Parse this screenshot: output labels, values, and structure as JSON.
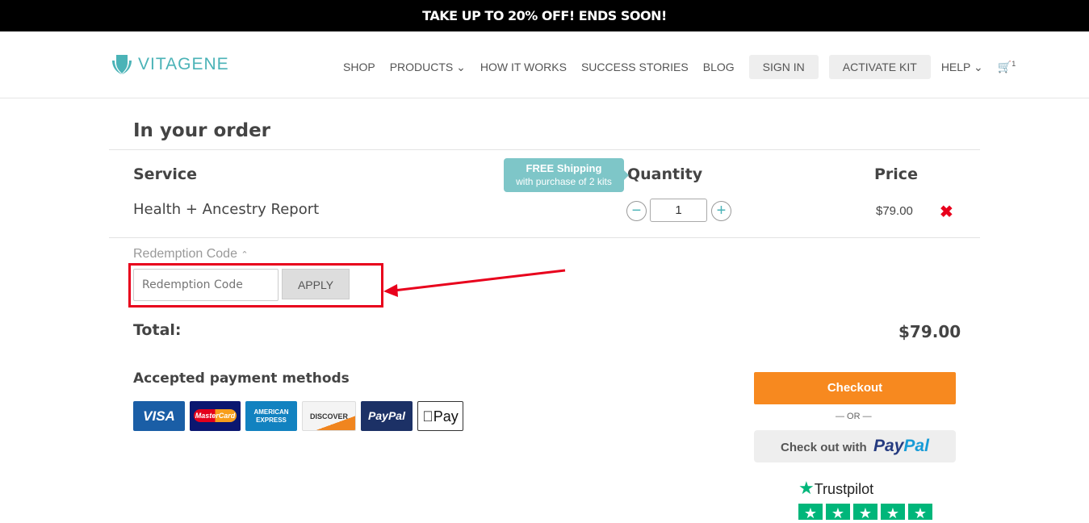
{
  "promo": "TAKE UP TO 20% OFF! ENDS SOON!",
  "logo": "VITAGENE",
  "nav": {
    "shop": "SHOP",
    "products": "PRODUCTS",
    "how": "HOW IT WORKS",
    "stories": "SUCCESS STORIES",
    "blog": "BLOG",
    "signin": "SIGN IN",
    "activate": "ACTIVATE KIT",
    "help": "HELP",
    "cart_count": "1"
  },
  "order": {
    "title": "In your order",
    "service_h": "Service",
    "quantity_h": "Quantity",
    "price_h": "Price",
    "tooltip_title": "FREE Shipping",
    "tooltip_sub": "with purchase of 2 kits",
    "item": "Health + Ancestry Report",
    "qty": "1",
    "price": "$79.00"
  },
  "redeem": {
    "label": "Redemption Code",
    "placeholder": "Redemption Code",
    "apply": "APPLY"
  },
  "total": {
    "label": "Total:",
    "value": "$79.00"
  },
  "payments": {
    "title": "Accepted payment methods",
    "visa": "VISA",
    "mastercard": "MasterCard",
    "amex": "AMERICAN EXPRESS",
    "discover": "DISCOVER",
    "paypal": "PayPal",
    "applepay": "Pay"
  },
  "checkout": {
    "button": "Checkout",
    "or": "— OR —",
    "paypal_prefix": "Check out with",
    "paypal_brand_a": "Pay",
    "paypal_brand_b": "Pal"
  },
  "trustpilot": "Trustpilot",
  "colors": {
    "accent": "#4bb3b7",
    "checkout": "#f7891f",
    "highlight": "#e8001c"
  }
}
